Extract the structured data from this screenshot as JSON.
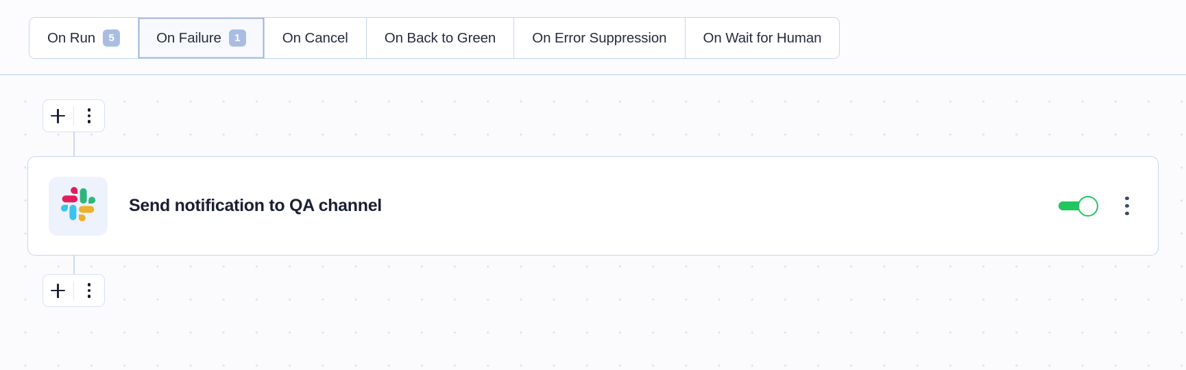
{
  "tabs": [
    {
      "label": "On Run",
      "badge": "5",
      "active": false
    },
    {
      "label": "On Failure",
      "badge": "1",
      "active": true
    },
    {
      "label": "On Cancel",
      "badge": null,
      "active": false
    },
    {
      "label": "On Back to Green",
      "badge": null,
      "active": false
    },
    {
      "label": "On Error Suppression",
      "badge": null,
      "active": false
    },
    {
      "label": "On Wait for Human",
      "badge": null,
      "active": false
    }
  ],
  "canvas": {
    "top_controls": {
      "add_label": "+",
      "add_icon": "plus-icon",
      "menu_icon": "vertical-dots-icon"
    },
    "bottom_controls": {
      "add_label": "+",
      "add_icon": "plus-icon",
      "menu_icon": "vertical-dots-icon"
    },
    "node": {
      "icon": "slack-icon",
      "title": "Send notification to QA channel",
      "toggle": {
        "name": "enabled-toggle",
        "state": "on"
      },
      "menu_icon": "vertical-dots-icon"
    }
  },
  "colors": {
    "accent_border": "#c2d5f1",
    "badge_bg": "#a9bde3",
    "toggle_on": "#22c55e",
    "canvas_bg": "#fbfbfd",
    "grid_dot": "#dbe5f8",
    "icon_tile_bg": "#eef2fd",
    "slack_blue": "#36c5f0",
    "slack_green": "#2eb67d",
    "slack_red": "#e01e5a",
    "slack_yellow": "#ecb22e"
  }
}
